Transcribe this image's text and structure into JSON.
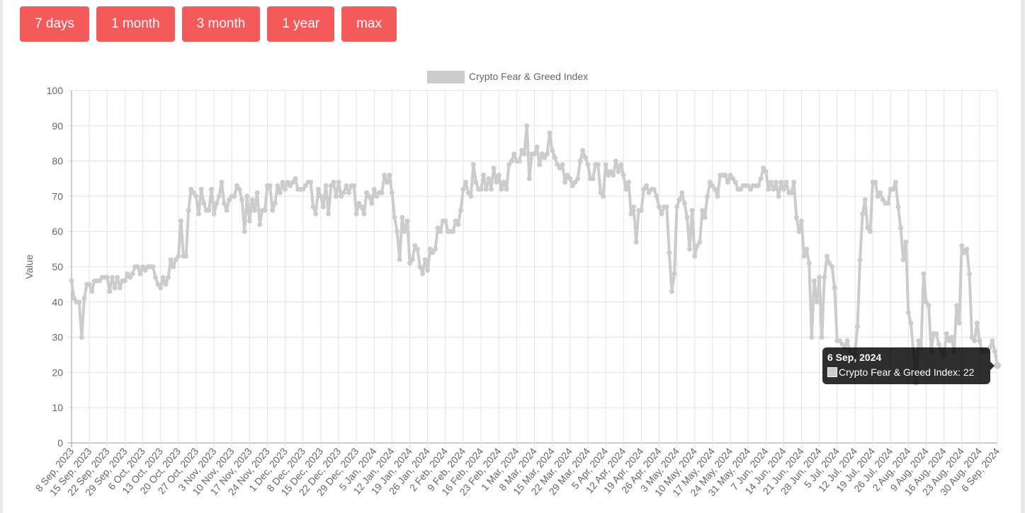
{
  "range_buttons": [
    "7 days",
    "1 month",
    "3 month",
    "1 year",
    "max"
  ],
  "tooltip": {
    "date": "6 Sep, 2024",
    "label": "Crypto Fear & Greed Index: 22"
  },
  "chart_data": {
    "type": "line",
    "legend": "Crypto Fear & Greed Index",
    "legend_position": "top",
    "series_color": "#cccccc",
    "ylabel": "Value",
    "ylim": [
      0,
      100
    ],
    "yticks": [
      0,
      10,
      20,
      30,
      40,
      50,
      60,
      70,
      80,
      90,
      100
    ],
    "grid": true,
    "start_date": "8 Sep, 2023",
    "end_date": "6 Sep, 2024",
    "xtick_labels": [
      "8 Sep, 2023",
      "15 Sep, 2023",
      "22 Sep, 2023",
      "29 Sep, 2023",
      "6 Oct, 2023",
      "13 Oct, 2023",
      "20 Oct, 2023",
      "27 Oct, 2023",
      "3 Nov, 2023",
      "10 Nov, 2023",
      "17 Nov, 2023",
      "24 Nov, 2023",
      "1 Dec, 2023",
      "8 Dec, 2023",
      "15 Dec, 2023",
      "22 Dec, 2023",
      "29 Dec, 2023",
      "5 Jan, 2024",
      "12 Jan, 2024",
      "19 Jan, 2024",
      "26 Jan, 2024",
      "2 Feb, 2024",
      "9 Feb, 2024",
      "16 Feb, 2024",
      "23 Feb, 2024",
      "1 Mar, 2024",
      "8 Mar, 2024",
      "15 Mar, 2024",
      "22 Mar, 2024",
      "29 Mar, 2024",
      "5 Apr, 2024",
      "12 Apr, 2024",
      "19 Apr, 2024",
      "26 Apr, 2024",
      "3 May, 2024",
      "10 May, 2024",
      "17 May, 2024",
      "24 May, 2024",
      "31 May, 2024",
      "7 Jun, 2024",
      "14 Jun, 2024",
      "21 Jun, 2024",
      "28 Jun, 2024",
      "5 Jul, 2024",
      "12 Jul, 2024",
      "19 Jul, 2024",
      "26 Jul, 2024",
      "2 Aug, 2024",
      "9 Aug, 2024",
      "16 Aug, 2024",
      "23 Aug, 2024",
      "30 Aug, 2024",
      "6 Sep, 2024"
    ],
    "values": [
      46,
      41,
      40,
      40,
      30,
      41,
      45,
      45,
      43,
      46,
      46,
      46,
      47,
      47,
      47,
      43,
      47,
      44,
      47,
      44,
      46,
      46,
      48,
      47,
      48,
      50,
      50,
      48,
      50,
      49,
      50,
      50,
      50,
      47,
      45,
      44,
      47,
      45,
      47,
      52,
      50,
      52,
      53,
      63,
      53,
      53,
      66,
      72,
      71,
      70,
      65,
      72,
      68,
      66,
      66,
      72,
      65,
      68,
      70,
      74,
      68,
      66,
      69,
      70,
      70,
      73,
      72,
      69,
      60,
      70,
      63,
      69,
      66,
      71,
      62,
      66,
      66,
      73,
      73,
      66,
      68,
      73,
      71,
      74,
      72,
      74,
      73,
      74,
      75,
      72,
      72,
      72,
      73,
      74,
      74,
      67,
      65,
      72,
      70,
      67,
      73,
      65,
      73,
      74,
      70,
      74,
      70,
      71,
      73,
      71,
      73,
      73,
      65,
      68,
      67,
      65,
      71,
      70,
      68,
      72,
      70,
      71,
      71,
      76,
      74,
      76,
      71,
      64,
      60,
      52,
      64,
      60,
      63,
      51,
      52,
      56,
      55,
      50,
      48,
      52,
      49,
      55,
      54,
      55,
      61,
      60,
      63,
      63,
      60,
      60,
      60,
      63,
      62,
      66,
      72,
      74,
      71,
      70,
      79,
      74,
      72,
      72,
      76,
      72,
      75,
      72,
      78,
      74,
      76,
      72,
      74,
      72,
      79,
      80,
      82,
      80,
      80,
      83,
      82,
      90,
      75,
      82,
      82,
      84,
      79,
      82,
      81,
      82,
      88,
      83,
      81,
      79,
      78,
      79,
      74,
      76,
      75,
      73,
      74,
      75,
      80,
      83,
      81,
      79,
      75,
      75,
      79,
      79,
      71,
      70,
      79,
      76,
      77,
      76,
      80,
      77,
      79,
      76,
      72,
      74,
      65,
      67,
      57,
      66,
      66,
      72,
      73,
      71,
      72,
      72,
      70,
      67,
      65,
      67,
      67,
      54,
      43,
      48,
      67,
      69,
      71,
      68,
      64,
      55,
      66,
      53,
      56,
      57,
      66,
      64,
      70,
      74,
      73,
      72,
      70,
      76,
      76,
      76,
      74,
      76,
      75,
      74,
      72,
      72,
      73,
      73,
      73,
      72,
      73,
      73,
      73,
      75,
      78,
      77,
      72,
      74,
      72,
      74,
      70,
      74,
      72,
      74,
      71,
      71,
      74,
      64,
      60,
      63,
      53,
      55,
      51,
      30,
      46,
      40,
      47,
      30,
      47,
      53,
      51,
      50,
      44,
      29,
      29,
      28,
      27,
      29,
      26,
      25,
      25,
      33,
      52,
      65,
      69,
      61,
      60,
      74,
      74,
      70,
      71,
      69,
      68,
      68,
      72,
      72,
      74,
      67,
      61,
      52,
      57,
      37,
      34,
      26,
      17,
      29,
      27,
      48,
      40,
      39,
      26,
      31,
      31,
      28,
      26,
      25,
      31,
      29,
      30,
      26,
      39,
      34,
      56,
      54,
      55,
      48,
      30,
      29,
      34,
      29,
      26,
      26,
      26,
      27,
      29,
      26,
      22
    ]
  }
}
